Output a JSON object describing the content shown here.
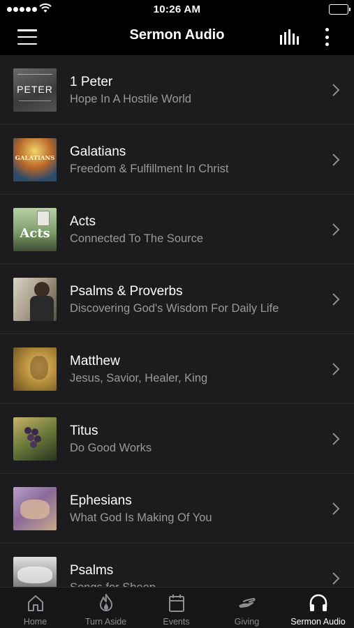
{
  "status": {
    "time": "10:26 AM"
  },
  "nav": {
    "title": "Sermon Audio"
  },
  "series": [
    {
      "title": "1 Peter",
      "subtitle": "Hope In A Hostile World",
      "thumb_text": "PETER"
    },
    {
      "title": "Galatians",
      "subtitle": "Freedom & Fulfillment In Christ",
      "thumb_text": "GALATIANS"
    },
    {
      "title": "Acts",
      "subtitle": "Connected To The Source",
      "thumb_text": "Acts"
    },
    {
      "title": "Psalms & Proverbs",
      "subtitle": "Discovering God's Wisdom For Daily Life",
      "thumb_text": ""
    },
    {
      "title": "Matthew",
      "subtitle": "Jesus, Savior, Healer, King",
      "thumb_text": ""
    },
    {
      "title": "Titus",
      "subtitle": "Do Good Works",
      "thumb_text": ""
    },
    {
      "title": "Ephesians",
      "subtitle": "What God Is Making Of You",
      "thumb_text": ""
    },
    {
      "title": "Psalms",
      "subtitle": "Songs for Sheep",
      "thumb_text": ""
    }
  ],
  "tabs": [
    {
      "label": "Home",
      "icon": "home-icon",
      "active": false
    },
    {
      "label": "Turn Aside",
      "icon": "flame-icon",
      "active": false
    },
    {
      "label": "Events",
      "icon": "calendar-icon",
      "active": false
    },
    {
      "label": "Giving",
      "icon": "giving-hand-icon",
      "active": false
    },
    {
      "label": "Sermon Audio",
      "icon": "headphones-icon",
      "active": true
    }
  ],
  "colors": {
    "background": "#000000",
    "list_background": "#1c1c1e",
    "subtitle": "#9a9a9e",
    "tab_inactive": "#8e8e93",
    "tab_active": "#ffffff"
  }
}
